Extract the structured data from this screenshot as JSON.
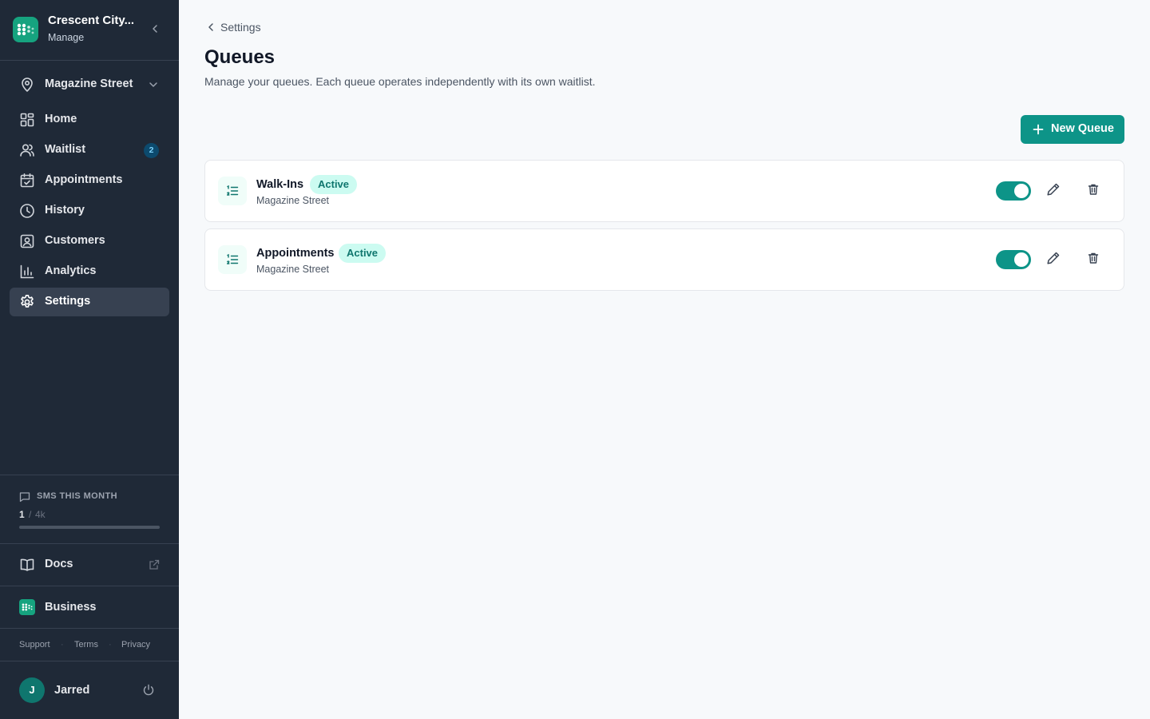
{
  "brand": {
    "name": "Crescent City...",
    "subtitle": "Manage"
  },
  "location_selector": {
    "label": "Magazine Street"
  },
  "nav": [
    {
      "label": "Home",
      "icon": "home-grid-icon"
    },
    {
      "label": "Waitlist",
      "icon": "users-icon",
      "badge": "2"
    },
    {
      "label": "Appointments",
      "icon": "calendar-check-icon"
    },
    {
      "label": "History",
      "icon": "clock-icon"
    },
    {
      "label": "Customers",
      "icon": "contact-icon"
    },
    {
      "label": "Analytics",
      "icon": "bar-chart-icon"
    },
    {
      "label": "Settings",
      "icon": "gear-icon",
      "active": true
    }
  ],
  "sms": {
    "title": "SMS THIS MONTH",
    "used": "1",
    "separator": "/",
    "limit": "4k",
    "usage_fraction": 0.00025
  },
  "docs": {
    "label": "Docs"
  },
  "business": {
    "label": "Business"
  },
  "legal": {
    "support": "Support",
    "terms": "Terms",
    "privacy": "Privacy",
    "dot": "·"
  },
  "user": {
    "initial": "J",
    "name": "Jarred"
  },
  "breadcrumb": {
    "label": "Settings"
  },
  "page": {
    "title": "Queues",
    "description": "Manage your queues. Each queue operates independently with its own waitlist."
  },
  "new_queue_button": {
    "label": "New Queue"
  },
  "queues": [
    {
      "name": "Walk-Ins",
      "status": "Active",
      "location": "Magazine Street",
      "enabled": true
    },
    {
      "name": "Appointments",
      "status": "Active",
      "location": "Magazine Street",
      "enabled": true
    }
  ],
  "colors": {
    "accent": "#0d9488",
    "sidebar": "#1f2937",
    "badge_bg": "#ccfbf1",
    "badge_text": "#0f766e"
  }
}
